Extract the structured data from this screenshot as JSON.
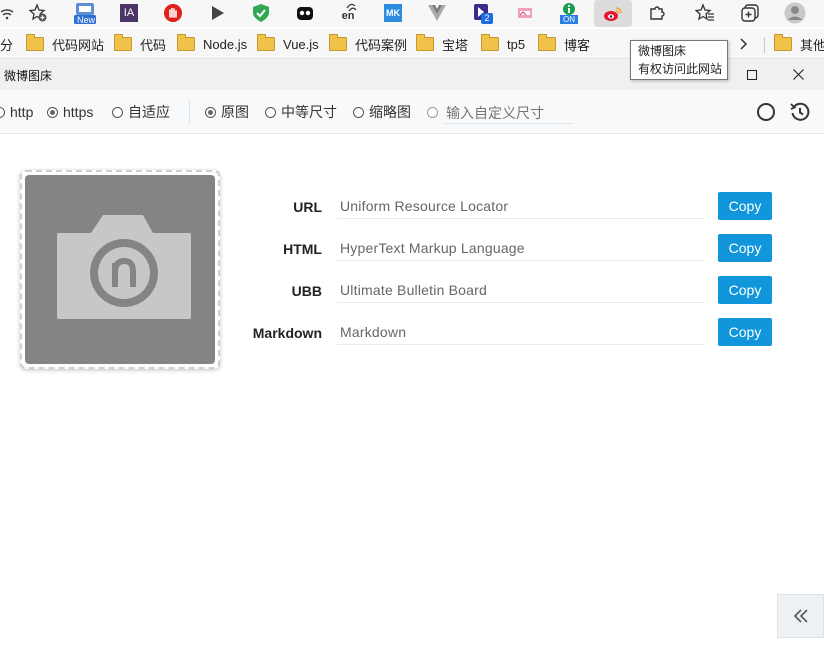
{
  "extensions": [
    {
      "icon": "wifi-icon"
    },
    {
      "icon": "star-add-icon"
    },
    {
      "icon": "new-badge-icon",
      "badge": "New"
    },
    {
      "icon": "ia-icon",
      "text": "IA"
    },
    {
      "icon": "hand-stop-icon"
    },
    {
      "icon": "play-icon"
    },
    {
      "icon": "shield-check-icon"
    },
    {
      "icon": "bear-mask-icon"
    },
    {
      "icon": "translate-icon",
      "text": "en"
    },
    {
      "icon": "mk-icon",
      "text": "MK"
    },
    {
      "icon": "vue-devtools-icon"
    },
    {
      "icon": "tab-counter-icon",
      "badge": "2"
    },
    {
      "icon": "picture-icon"
    },
    {
      "icon": "info-on-icon",
      "badge": "ON"
    },
    {
      "icon": "weibo-icon"
    },
    {
      "icon": "puzzle-icon"
    },
    {
      "icon": "favorites-icon"
    },
    {
      "icon": "collections-icon"
    },
    {
      "icon": "profile-icon"
    }
  ],
  "bookmarks": {
    "items": [
      {
        "label": "分"
      },
      {
        "label": "代码网站"
      },
      {
        "label": "代码"
      },
      {
        "label": "Node.js"
      },
      {
        "label": "Vue.js"
      },
      {
        "label": "代码案例"
      },
      {
        "label": "宝塔"
      },
      {
        "label": "tp5"
      },
      {
        "label": "博客"
      }
    ],
    "other_label": "其他收"
  },
  "tooltip": {
    "line1": "微博图床",
    "line2": "有权访问此网站"
  },
  "popup": {
    "title": "微博图床"
  },
  "options": {
    "protocol": [
      {
        "label": "http",
        "selected": false
      },
      {
        "label": "https",
        "selected": true
      },
      {
        "label": "自适应",
        "selected": false
      }
    ],
    "size": [
      {
        "label": "原图",
        "selected": true
      },
      {
        "label": "中等尺寸",
        "selected": false
      },
      {
        "label": "缩略图",
        "selected": false
      },
      {
        "label": "",
        "selected": false
      }
    ],
    "custom_placeholder": "输入自定义尺寸"
  },
  "links": [
    {
      "label": "URL",
      "value": "Uniform Resource Locator",
      "button": "Copy"
    },
    {
      "label": "HTML",
      "value": "HyperText Markup Language",
      "button": "Copy"
    },
    {
      "label": "UBB",
      "value": "Ultimate Bulletin Board",
      "button": "Copy"
    },
    {
      "label": "Markdown",
      "value": "Markdown",
      "button": "Copy"
    }
  ],
  "colors": {
    "accent": "#1296db",
    "placeholder_bg": "#848484"
  }
}
